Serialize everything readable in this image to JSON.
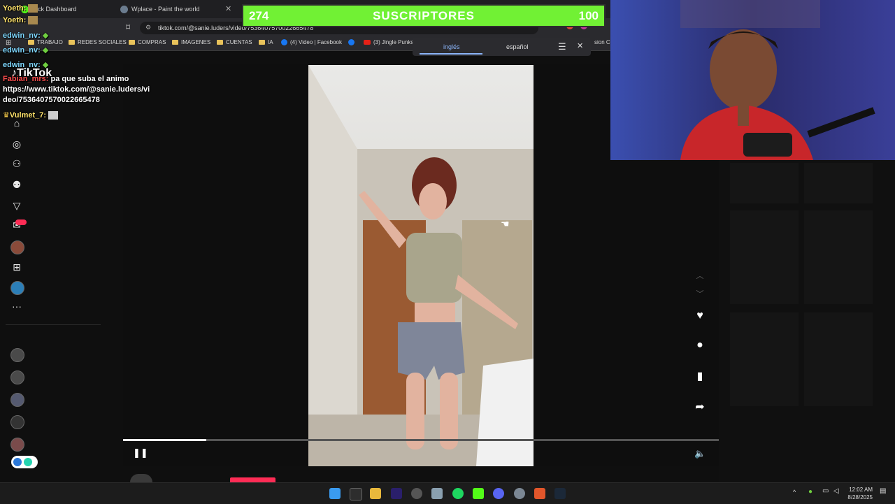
{
  "browser": {
    "tabs": [
      {
        "label": "Kick Dashboard"
      },
      {
        "label": "Wplace - Paint the world"
      }
    ],
    "url": "tiktok.com/@sanie.luders/video/7536407570022665478",
    "bookmarks": [
      {
        "label": "TRABAJO",
        "icon": "folder-icon"
      },
      {
        "label": "REDES SOCIALES",
        "icon": "folder-icon"
      },
      {
        "label": "COMPRAS",
        "icon": "folder-icon"
      },
      {
        "label": "IMAGENES",
        "icon": "folder-icon"
      },
      {
        "label": "CUENTAS",
        "icon": "folder-icon"
      },
      {
        "label": "IA",
        "icon": "folder-icon"
      },
      {
        "label": "(4) Video | Facebook",
        "icon": "facebook-icon"
      },
      {
        "label": "(3) Jingle Punks",
        "icon": "youtube-icon"
      },
      {
        "label": "sion Cl",
        "icon": "folder-icon"
      }
    ]
  },
  "translate": {
    "source": "inglés",
    "target": "español"
  },
  "overlay": {
    "subscribers_count": "274",
    "subscribers_label": "SUSCRIPTORES",
    "subscribers_goal": "100"
  },
  "chat": [
    {
      "user": "Yoeth:",
      "message": ""
    },
    {
      "user": "Yoeth:",
      "message": ""
    },
    {
      "user": "edwin_nv:",
      "message": ""
    },
    {
      "user": "edwin_nv:",
      "message": ""
    },
    {
      "user": "edwin_nv:",
      "message": ""
    },
    {
      "user": "Fabian_mrs:",
      "message": "pa que suba el animo"
    },
    {
      "user": "",
      "message": "https://www.tiktok.com/@sanie.luders/vi"
    },
    {
      "user": "",
      "message": "deo/7536407570022665478"
    },
    {
      "user": "Vulmet_7:",
      "message": ""
    }
  ],
  "tiktok": {
    "logo": "TikTok"
  },
  "video": {
    "progress_fraction": 0.14
  },
  "taskbar": {
    "time": "12:02 AM",
    "date": "8/28/2025"
  }
}
